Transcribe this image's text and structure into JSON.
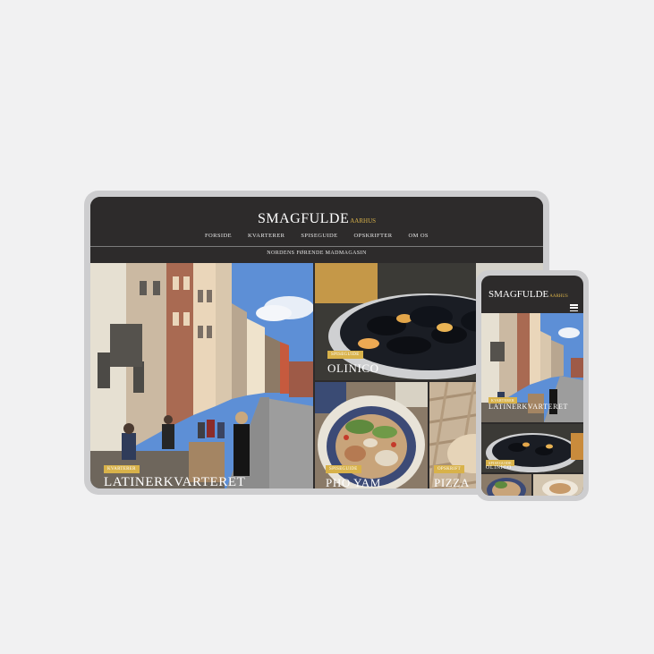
{
  "site": {
    "logo_main": "SMAGFULDE",
    "logo_city": "AARHUS",
    "tagline": "NORDENS FØRENDE MADMAGASIN",
    "nav": [
      "FORSIDE",
      "KVARTERER",
      "SPISEGUIDE",
      "OPSKRIFTER",
      "OM OS"
    ]
  },
  "tiles": {
    "latin": {
      "badge": "KVARTERER",
      "title": "LATINERKVARTERET"
    },
    "olinico": {
      "badge": "SPISEGUIDE",
      "title": "OLINICO"
    },
    "pho": {
      "badge": "SPISEGUIDE",
      "title": "PHO YAM"
    },
    "pizza": {
      "badge": "OPSKRIFT",
      "title": "PIZZA"
    }
  },
  "phone": {
    "latin_badge": "KVARTERER",
    "latin_title": "LATINERKVARTERET",
    "olinico_badge": "SPISEGUIDE",
    "olinico_title": "OLINICO"
  },
  "icons": [
    "hamburger-menu-icon"
  ],
  "colors": {
    "accent": "#d8b24a",
    "header": "#2d2b2b",
    "frame": "#cdcdcf",
    "background": "#f1f1f2"
  }
}
